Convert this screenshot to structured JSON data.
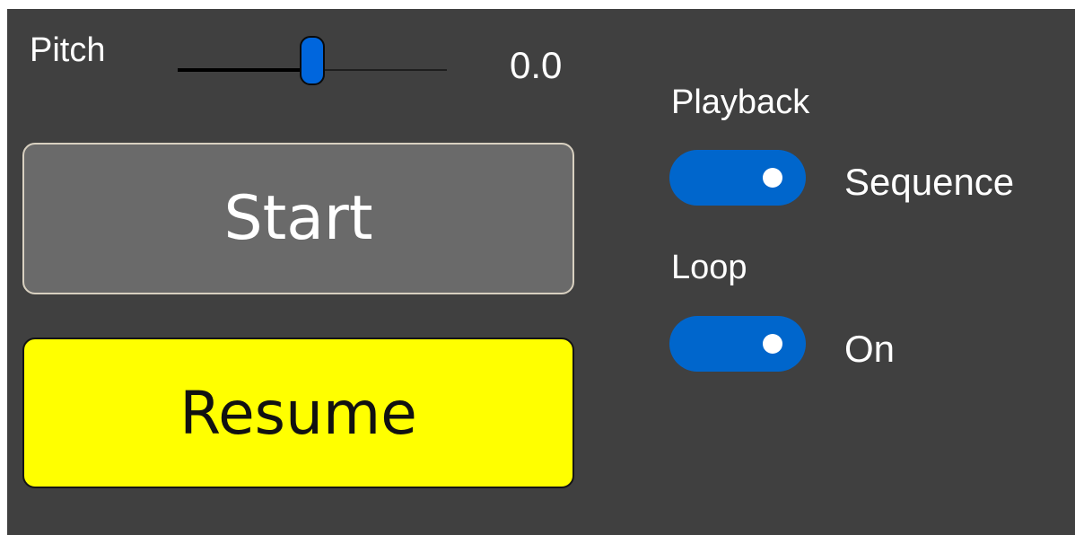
{
  "pitch": {
    "label": "Pitch",
    "value_text": "0.0",
    "slider_fraction": 0.5
  },
  "buttons": {
    "start_label": "Start",
    "resume_label": "Resume"
  },
  "playback": {
    "label": "Playback",
    "toggle_on": true,
    "toggle_text": "Sequence"
  },
  "loop": {
    "label": "Loop",
    "toggle_on": true,
    "toggle_text": "On"
  },
  "colors": {
    "background": "#404040",
    "accent": "#0066cc",
    "resume_button": "#ffff00",
    "start_button": "#6a6a6a"
  }
}
